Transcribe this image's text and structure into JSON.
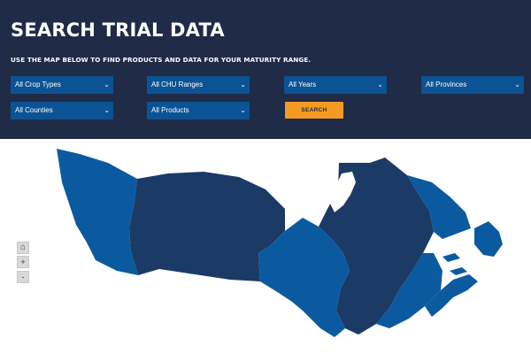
{
  "header": {
    "title": "SEARCH TRIAL DATA",
    "subtitle": "USE THE MAP BELOW TO FIND PRODUCTS AND DATA FOR YOUR MATURITY RANGE."
  },
  "filters": {
    "crop_types": "All Crop Types",
    "chu_ranges": "All CHU Ranges",
    "years": "All Years",
    "provinces": "All Provinces",
    "counties": "All Counties",
    "products": "All Products",
    "search_label": "SEARCH"
  },
  "map_controls": {
    "home_icon": "home-icon",
    "zoom_in": "+",
    "zoom_out": "-"
  },
  "colors": {
    "header_bg": "#1f2b47",
    "select_bg": "#0b5394",
    "search_btn": "#f49a22",
    "map_dark": "#1b3a66",
    "map_light": "#0b5aa0"
  }
}
